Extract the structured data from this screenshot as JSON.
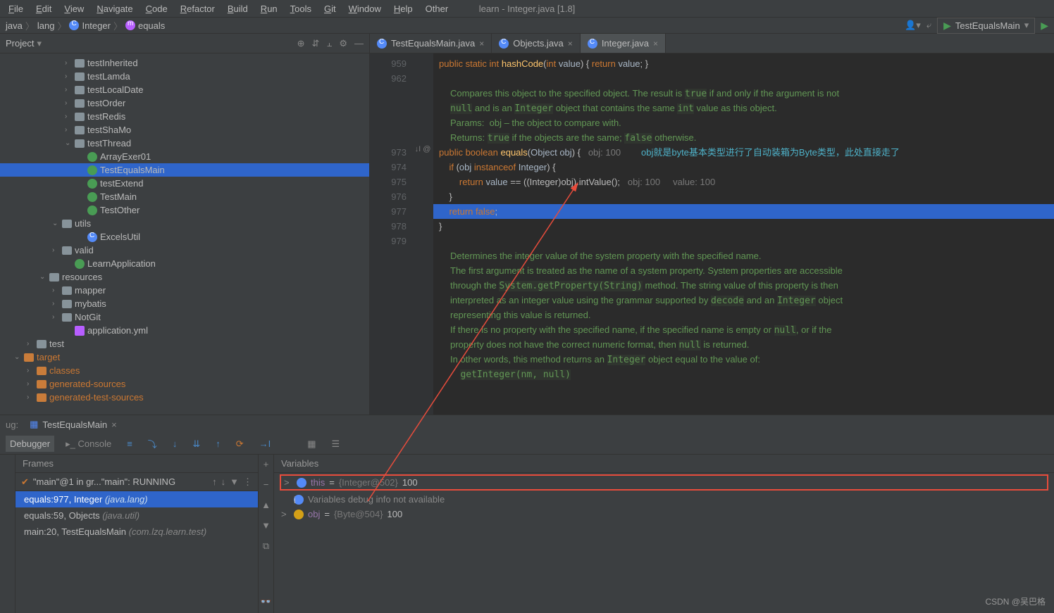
{
  "window_title": "learn - Integer.java [1.8]",
  "menu": [
    "File",
    "Edit",
    "View",
    "Navigate",
    "Code",
    "Refactor",
    "Build",
    "Run",
    "Tools",
    "Git",
    "Window",
    "Help",
    "Other"
  ],
  "menu_underline": [
    "F",
    "E",
    "V",
    "N",
    "C",
    "R",
    "B",
    "R",
    "T",
    "G",
    "W",
    "H",
    ""
  ],
  "breadcrumb": {
    "root": "java",
    "pkg": "lang",
    "class": "Integer",
    "method": "equals"
  },
  "run_config": "TestEqualsMain",
  "project_title": "Project",
  "tree": [
    {
      "indent": 4,
      "arrow": ">",
      "icon": "dir",
      "label": "testInherited"
    },
    {
      "indent": 4,
      "arrow": ">",
      "icon": "dir",
      "label": "testLamda"
    },
    {
      "indent": 4,
      "arrow": ">",
      "icon": "dir",
      "label": "testLocalDate"
    },
    {
      "indent": 4,
      "arrow": ">",
      "icon": "dir",
      "label": "testOrder"
    },
    {
      "indent": 4,
      "arrow": ">",
      "icon": "dir",
      "label": "testRedis"
    },
    {
      "indent": 4,
      "arrow": ">",
      "icon": "dir",
      "label": "testShaMo"
    },
    {
      "indent": 4,
      "arrow": "v",
      "icon": "dir",
      "label": "testThread"
    },
    {
      "indent": 5,
      "arrow": "",
      "icon": "class-green",
      "label": "ArrayExer01"
    },
    {
      "indent": 5,
      "arrow": "",
      "icon": "class-green",
      "label": "TestEqualsMain",
      "selected": true
    },
    {
      "indent": 5,
      "arrow": "",
      "icon": "class-green",
      "label": "testExtend"
    },
    {
      "indent": 5,
      "arrow": "",
      "icon": "class-green",
      "label": "TestMain"
    },
    {
      "indent": 5,
      "arrow": "",
      "icon": "class-green",
      "label": "TestOther"
    },
    {
      "indent": 3,
      "arrow": "v",
      "icon": "dir",
      "label": "utils"
    },
    {
      "indent": 5,
      "arrow": "",
      "icon": "class",
      "label": "ExcelsUtil"
    },
    {
      "indent": 3,
      "arrow": ">",
      "icon": "dir",
      "label": "valid"
    },
    {
      "indent": 4,
      "arrow": "",
      "icon": "class-green",
      "label": "LearnApplication"
    },
    {
      "indent": 2,
      "arrow": "v",
      "icon": "dir",
      "label": "resources"
    },
    {
      "indent": 3,
      "arrow": ">",
      "icon": "dir",
      "label": "mapper"
    },
    {
      "indent": 3,
      "arrow": ">",
      "icon": "dir",
      "label": "mybatis"
    },
    {
      "indent": 3,
      "arrow": ">",
      "icon": "dir",
      "label": "NotGit"
    },
    {
      "indent": 4,
      "arrow": "",
      "icon": "yml",
      "label": "application.yml"
    },
    {
      "indent": 1,
      "arrow": ">",
      "icon": "dir",
      "label": "test"
    },
    {
      "indent": 0,
      "arrow": "v",
      "icon": "dir-orange",
      "label": "target",
      "orange": true
    },
    {
      "indent": 1,
      "arrow": ">",
      "icon": "dir-orange",
      "label": "classes",
      "orange": true
    },
    {
      "indent": 1,
      "arrow": ">",
      "icon": "dir-orange",
      "label": "generated-sources",
      "orange": true
    },
    {
      "indent": 1,
      "arrow": ">",
      "icon": "dir-orange",
      "label": "generated-test-sources",
      "orange": true
    }
  ],
  "tabs": [
    {
      "label": "TestEqualsMain.java",
      "active": false
    },
    {
      "label": "Objects.java",
      "active": false
    },
    {
      "label": "Integer.java",
      "active": true
    }
  ],
  "code": {
    "lines": [
      {
        "n": "959",
        "html": "<span class='kw'>public static int</span> <span class='fn'>hashCode</span>(<span class='kw'>int</span> <span class='param'>value</span>) { <span class='kw'>return</span> <span class='param'>value</span>; }"
      },
      {
        "n": "962",
        "html": ""
      },
      {
        "n": "",
        "doc": true,
        "html": "Compares this object to the specified object. The result is <span class='code-tag'>true</span> if and only if the argument is not"
      },
      {
        "n": "",
        "doc": true,
        "html": "<span class='code-tag'>null</span> and is an <span class='code-tag'>Integer</span> object that contains the same <span class='code-tag'>int</span> value as this object."
      },
      {
        "n": "",
        "doc": true,
        "html": "Params:  obj – the object to compare with."
      },
      {
        "n": "",
        "doc": true,
        "html": "Returns: <span class='code-tag'>true</span> if the objects are the same; <span class='code-tag'>false</span> otherwise."
      },
      {
        "n": "973",
        "mark": "↓I @",
        "html": "<span class='kw'>public boolean</span> <span class='fn'>equals</span>(<span class='param'>Object obj</span>) {   <span class='hint'>obj: 100</span>        <span class='anno'>obj就是byte基本类型进行了自动装箱为Byte类型，此处直接走了</span>"
      },
      {
        "n": "974",
        "html": "    <span class='kw'>if</span> (<span class='param'>obj</span> <span class='kw'>instanceof</span> <span class='param'>Integer</span>) {"
      },
      {
        "n": "975",
        "html": "        <span class='kw'>return</span> <span class='param'>value</span> == ((Integer)obj).intValue();   <span class='hint'>obj: 100     value: 100</span>"
      },
      {
        "n": "976",
        "html": "    }"
      },
      {
        "n": "977",
        "hl": true,
        "html": "    <span class='kw'>return false</span>;"
      },
      {
        "n": "978",
        "html": "}"
      },
      {
        "n": "979",
        "html": ""
      },
      {
        "n": "",
        "doc": true,
        "html": "Determines the integer value of the system property with the specified name."
      },
      {
        "n": "",
        "doc": true,
        "html": "The first argument is treated as the name of a system property. System properties are accessible"
      },
      {
        "n": "",
        "doc": true,
        "html": "through the <span class='code-tag'>System.getProperty(String)</span> method. The string value of this property is then"
      },
      {
        "n": "",
        "doc": true,
        "html": "interpreted as an integer value using the grammar supported by <span class='code-tag'>decode</span> and an <span class='code-tag'>Integer</span> object"
      },
      {
        "n": "",
        "doc": true,
        "html": "representing this value is returned."
      },
      {
        "n": "",
        "doc": true,
        "html": "If there is no property with the specified name, if the specified name is empty or <span class='code-tag'>null</span>, or if the"
      },
      {
        "n": "",
        "doc": true,
        "html": "property does not have the correct numeric format, then <span class='code-tag'>null</span> is returned."
      },
      {
        "n": "",
        "doc": true,
        "html": "In other words, this method returns an <span class='code-tag'>Integer</span> object equal to the value of:"
      },
      {
        "n": "",
        "doc": true,
        "html": "    <span class='code-tag'>getInteger(nm, null)</span>"
      }
    ]
  },
  "debug": {
    "tab_label": "TestEqualsMain",
    "sub_debugger": "Debugger",
    "sub_console": "Console",
    "frames_title": "Frames",
    "vars_title": "Variables",
    "thread": "\"main\"@1 in gr...\"main\": RUNNING",
    "frames": [
      {
        "text": "equals:977, Integer",
        "pkg": "(java.lang)",
        "sel": true
      },
      {
        "text": "equals:59, Objects",
        "pkg": "(java.util)"
      },
      {
        "text": "main:20, TestEqualsMain",
        "pkg": "(com.lzq.learn.test)"
      }
    ],
    "vars": [
      {
        "boxed": true,
        "arrow": ">",
        "icon": "blue",
        "name": "this",
        "eq": " = ",
        "type": "{Integer@502}",
        "val": " 100"
      },
      {
        "arrow": "",
        "icon": "blue",
        "name": "",
        "eq": "",
        "type": "Variables debug info not available",
        "val": "",
        "info": true
      },
      {
        "arrow": ">",
        "icon": "gold",
        "name": "obj",
        "eq": " = ",
        "type": "{Byte@504}",
        "val": " 100"
      }
    ]
  },
  "watermark": "CSDN @吴巴格"
}
